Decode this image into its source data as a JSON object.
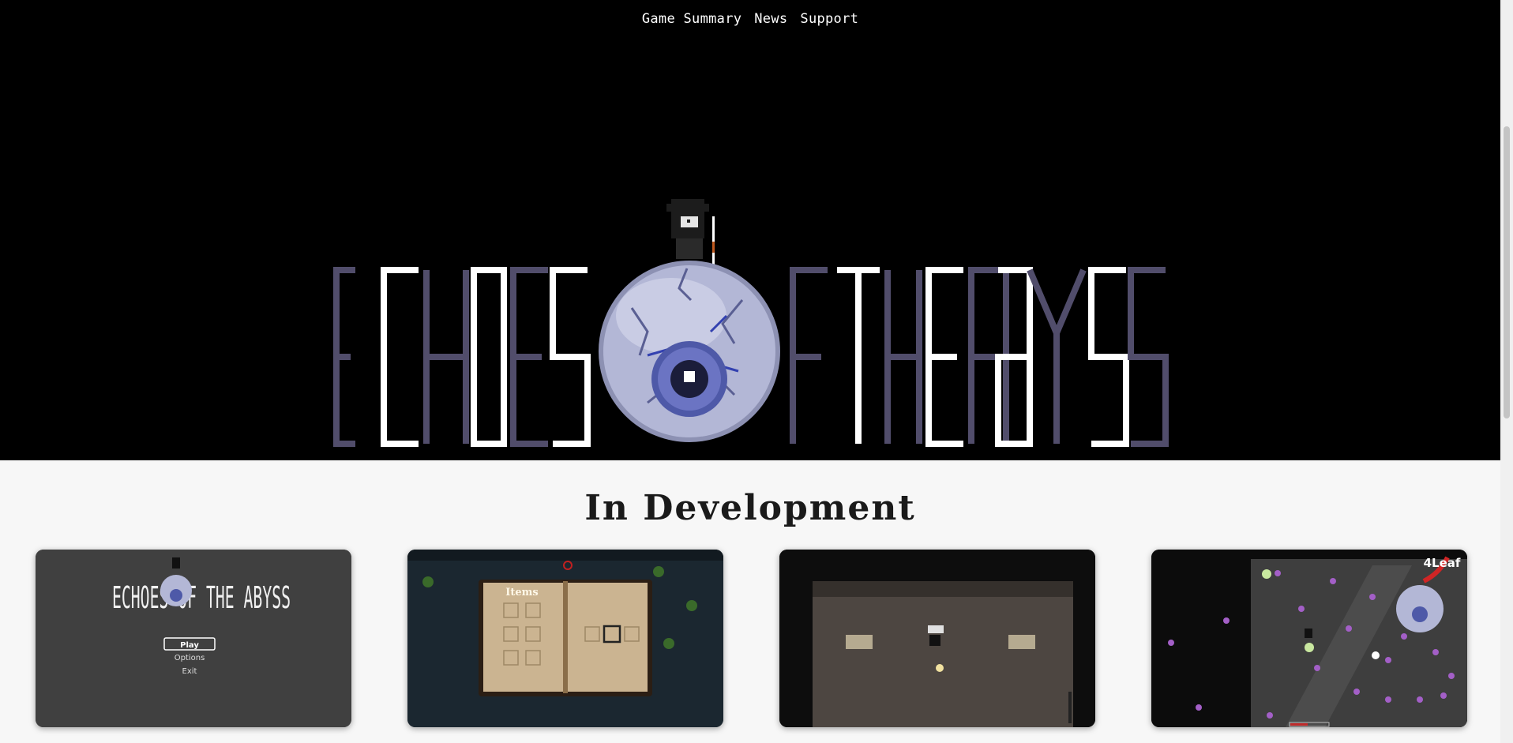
{
  "nav": {
    "items": [
      {
        "label": "Game Summary"
      },
      {
        "label": "News"
      },
      {
        "label": "Support"
      }
    ]
  },
  "hero": {
    "logo_text": "ECHOES OF THE ABYSS",
    "logo_colors": {
      "purple": "#514d6b",
      "white": "#ffffff",
      "eye": "#b9bdd9",
      "iris": "#4a56a8"
    }
  },
  "development": {
    "heading": "In Development",
    "cards": [
      {
        "name": "title-screen",
        "logo_text": "ECHOES OF THE ABYSS",
        "menu": [
          "Play",
          "Options",
          "Exit"
        ]
      },
      {
        "name": "inventory-book",
        "book_title": "Items"
      },
      {
        "name": "room-interior"
      },
      {
        "name": "boss-fight",
        "overlay_text": "4Leaf"
      }
    ]
  },
  "colors": {
    "hero_bg": "#000000",
    "page_bg": "#f7f7f7",
    "card1_bg": "#404040",
    "card2_bg": "#1b2730",
    "card3_bg": "#4a4440",
    "card4_bg": "#101010"
  }
}
